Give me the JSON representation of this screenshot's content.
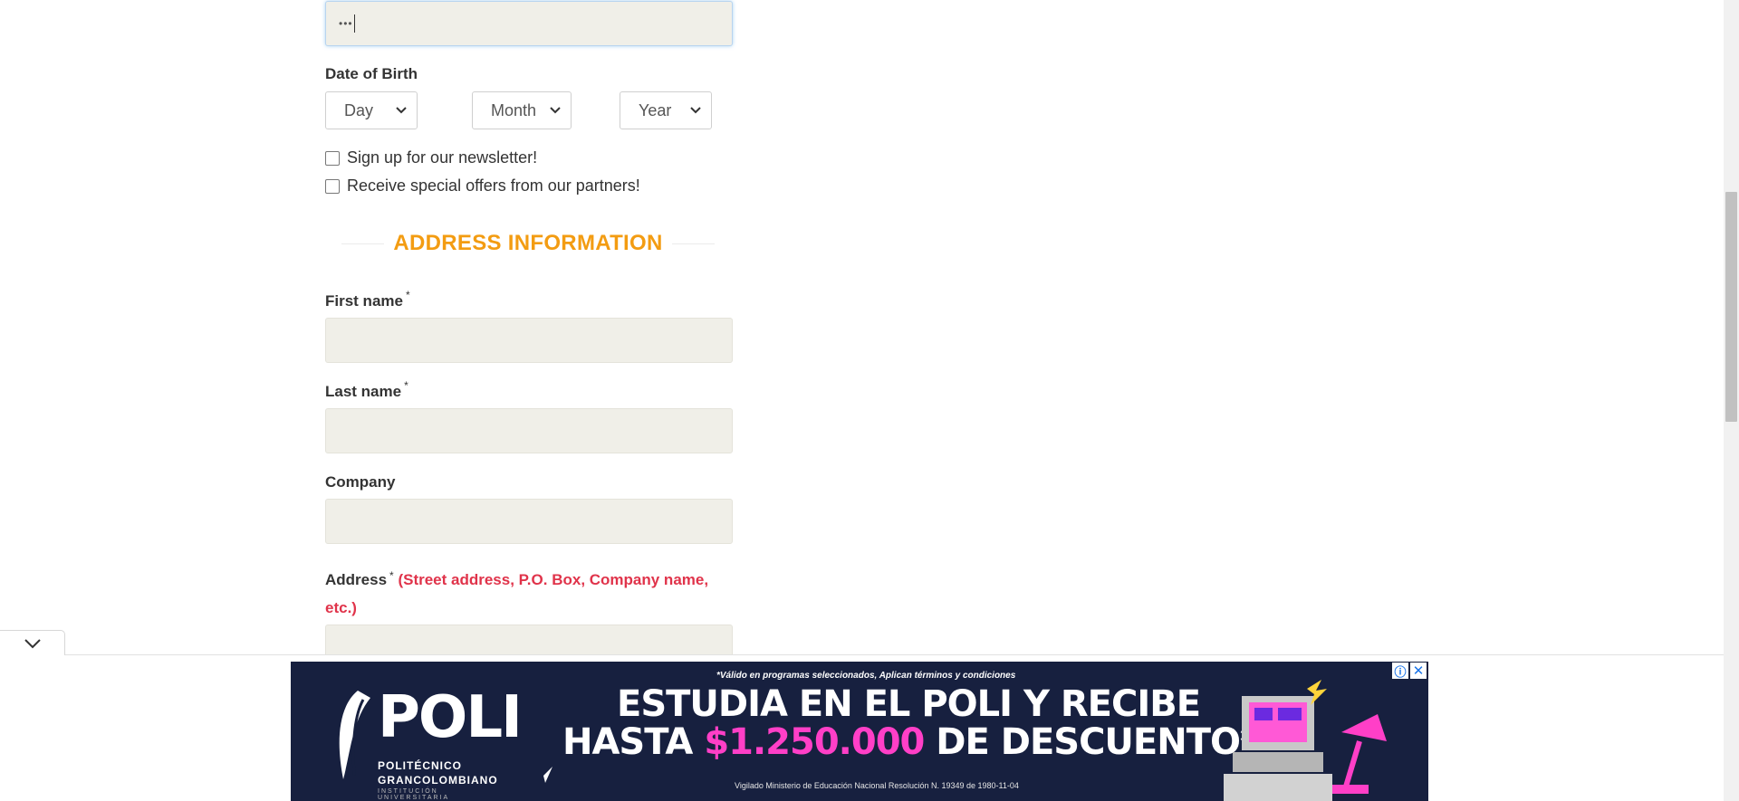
{
  "password_field": {
    "value": "•••"
  },
  "dob": {
    "label": "Date of Birth",
    "day": "Day",
    "month": "Month",
    "year": "Year"
  },
  "newsletter": {
    "label": "Sign up for our newsletter!"
  },
  "offers": {
    "label": "Receive special offers from our partners!"
  },
  "section": {
    "title": "ADDRESS INFORMATION"
  },
  "first_name": {
    "label": "First name",
    "required": "*"
  },
  "last_name": {
    "label": "Last name",
    "required": "*"
  },
  "company": {
    "label": "Company"
  },
  "address": {
    "label": "Address",
    "required": "*",
    "hint_line1": "(Street address, P.O. Box, Company name,",
    "hint_line2": "etc.)"
  },
  "ad": {
    "fine_print": "*Válido en programas seleccionados, Aplican términos y condiciones",
    "headline_line1": "ESTUDIA EN EL POLI Y RECIBE",
    "headline_line2_pre": "HASTA ",
    "headline_line2_highlight": "$1.250.000",
    "headline_line2_post": " DE DESCUENTO*",
    "logo_word": "POLI",
    "logo_sub1": "POLITÉCNICO",
    "logo_sub2": "GRANCOLOMBIANO",
    "logo_sub3": "INSTITUCIÓN UNIVERSITARIA",
    "footer": "Vigilado Ministerio de Educación Nacional Resolución N. 19349 de 1980-11-04",
    "info_icon": "info-icon",
    "close_icon": "close-icon"
  },
  "colors": {
    "accent_orange": "#f39c12",
    "hint_red": "#e0334a",
    "input_bg": "#f0efe8",
    "ad_bg": "#17203f",
    "ad_highlight": "#ff3fc7"
  }
}
